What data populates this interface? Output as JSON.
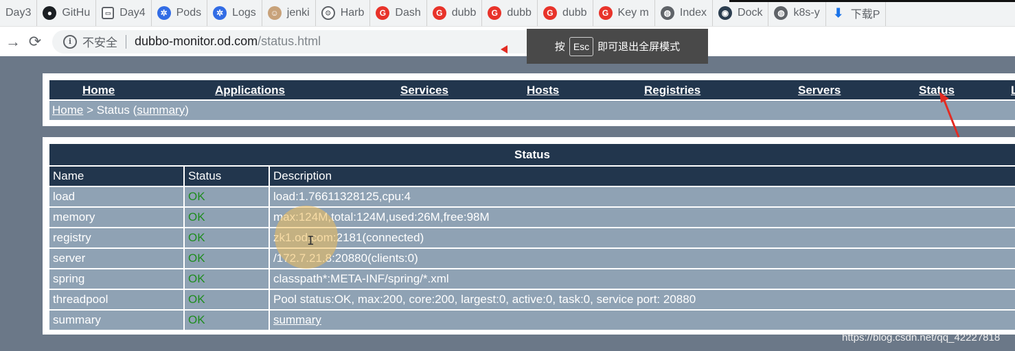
{
  "bookmarks": [
    {
      "label": "Day3",
      "icon": "page-icon"
    },
    {
      "label": "GitHu",
      "icon": "github-icon"
    },
    {
      "label": "Day4",
      "icon": "page-icon"
    },
    {
      "label": "Pods",
      "icon": "kubernetes-icon"
    },
    {
      "label": "Logs",
      "icon": "kubernetes-icon"
    },
    {
      "label": "jenki",
      "icon": "jenkins-icon"
    },
    {
      "label": "Harb",
      "icon": "harbor-icon"
    },
    {
      "label": "Dash",
      "icon": "g-icon"
    },
    {
      "label": "dubb",
      "icon": "g-icon"
    },
    {
      "label": "dubb",
      "icon": "g-icon"
    },
    {
      "label": "dubb",
      "icon": "g-icon"
    },
    {
      "label": "Key m",
      "icon": "g-icon"
    },
    {
      "label": "Index",
      "icon": "globe-icon"
    },
    {
      "label": "Dock",
      "icon": "docker-icon"
    },
    {
      "label": "k8s-y",
      "icon": "globe-icon"
    },
    {
      "label": "下载P",
      "icon": "download-icon"
    }
  ],
  "address": {
    "security_label": "不安全",
    "host": "dubbo-monitor.od.com",
    "path": "/status.html"
  },
  "fullscreen_toast": {
    "prefix": "按",
    "key": "Esc",
    "suffix": "即可退出全屏模式"
  },
  "menu": {
    "home": "Home",
    "applications": "Applications",
    "services": "Services",
    "hosts": "Hosts",
    "registries": "Registries",
    "servers": "Servers",
    "status": "Status",
    "more": "L"
  },
  "breadcrumb": {
    "home": "Home",
    "separator": " > Status (",
    "summary": "summary",
    "close": ")"
  },
  "status_table": {
    "caption": "Status",
    "headers": [
      "Name",
      "Status",
      "Description"
    ],
    "rows": [
      {
        "name": "load",
        "status": "OK",
        "description": "load:1.76611328125,cpu:4"
      },
      {
        "name": "memory",
        "status": "OK",
        "description": "max:124M,total:124M,used:26M,free:98M"
      },
      {
        "name": "registry",
        "status": "OK",
        "description": "zk1.od.com:2181(connected)"
      },
      {
        "name": "server",
        "status": "OK",
        "description": "/172.7.21.8:20880(clients:0)"
      },
      {
        "name": "spring",
        "status": "OK",
        "description": "classpath*:META-INF/spring/*.xml"
      },
      {
        "name": "threadpool",
        "status": "OK",
        "description": "Pool status:OK, max:200, core:200, largest:0, active:0, task:0, service port: 20880"
      },
      {
        "name": "summary",
        "status": "OK",
        "description": "summary"
      }
    ]
  },
  "watermark": "https://blog.csdn.net/qq_42227818",
  "colors": {
    "header_bg": "#22364d",
    "row_bg": "#8fa2b4",
    "ok_text": "#1e8c1e",
    "page_bg": "#6b7888"
  }
}
